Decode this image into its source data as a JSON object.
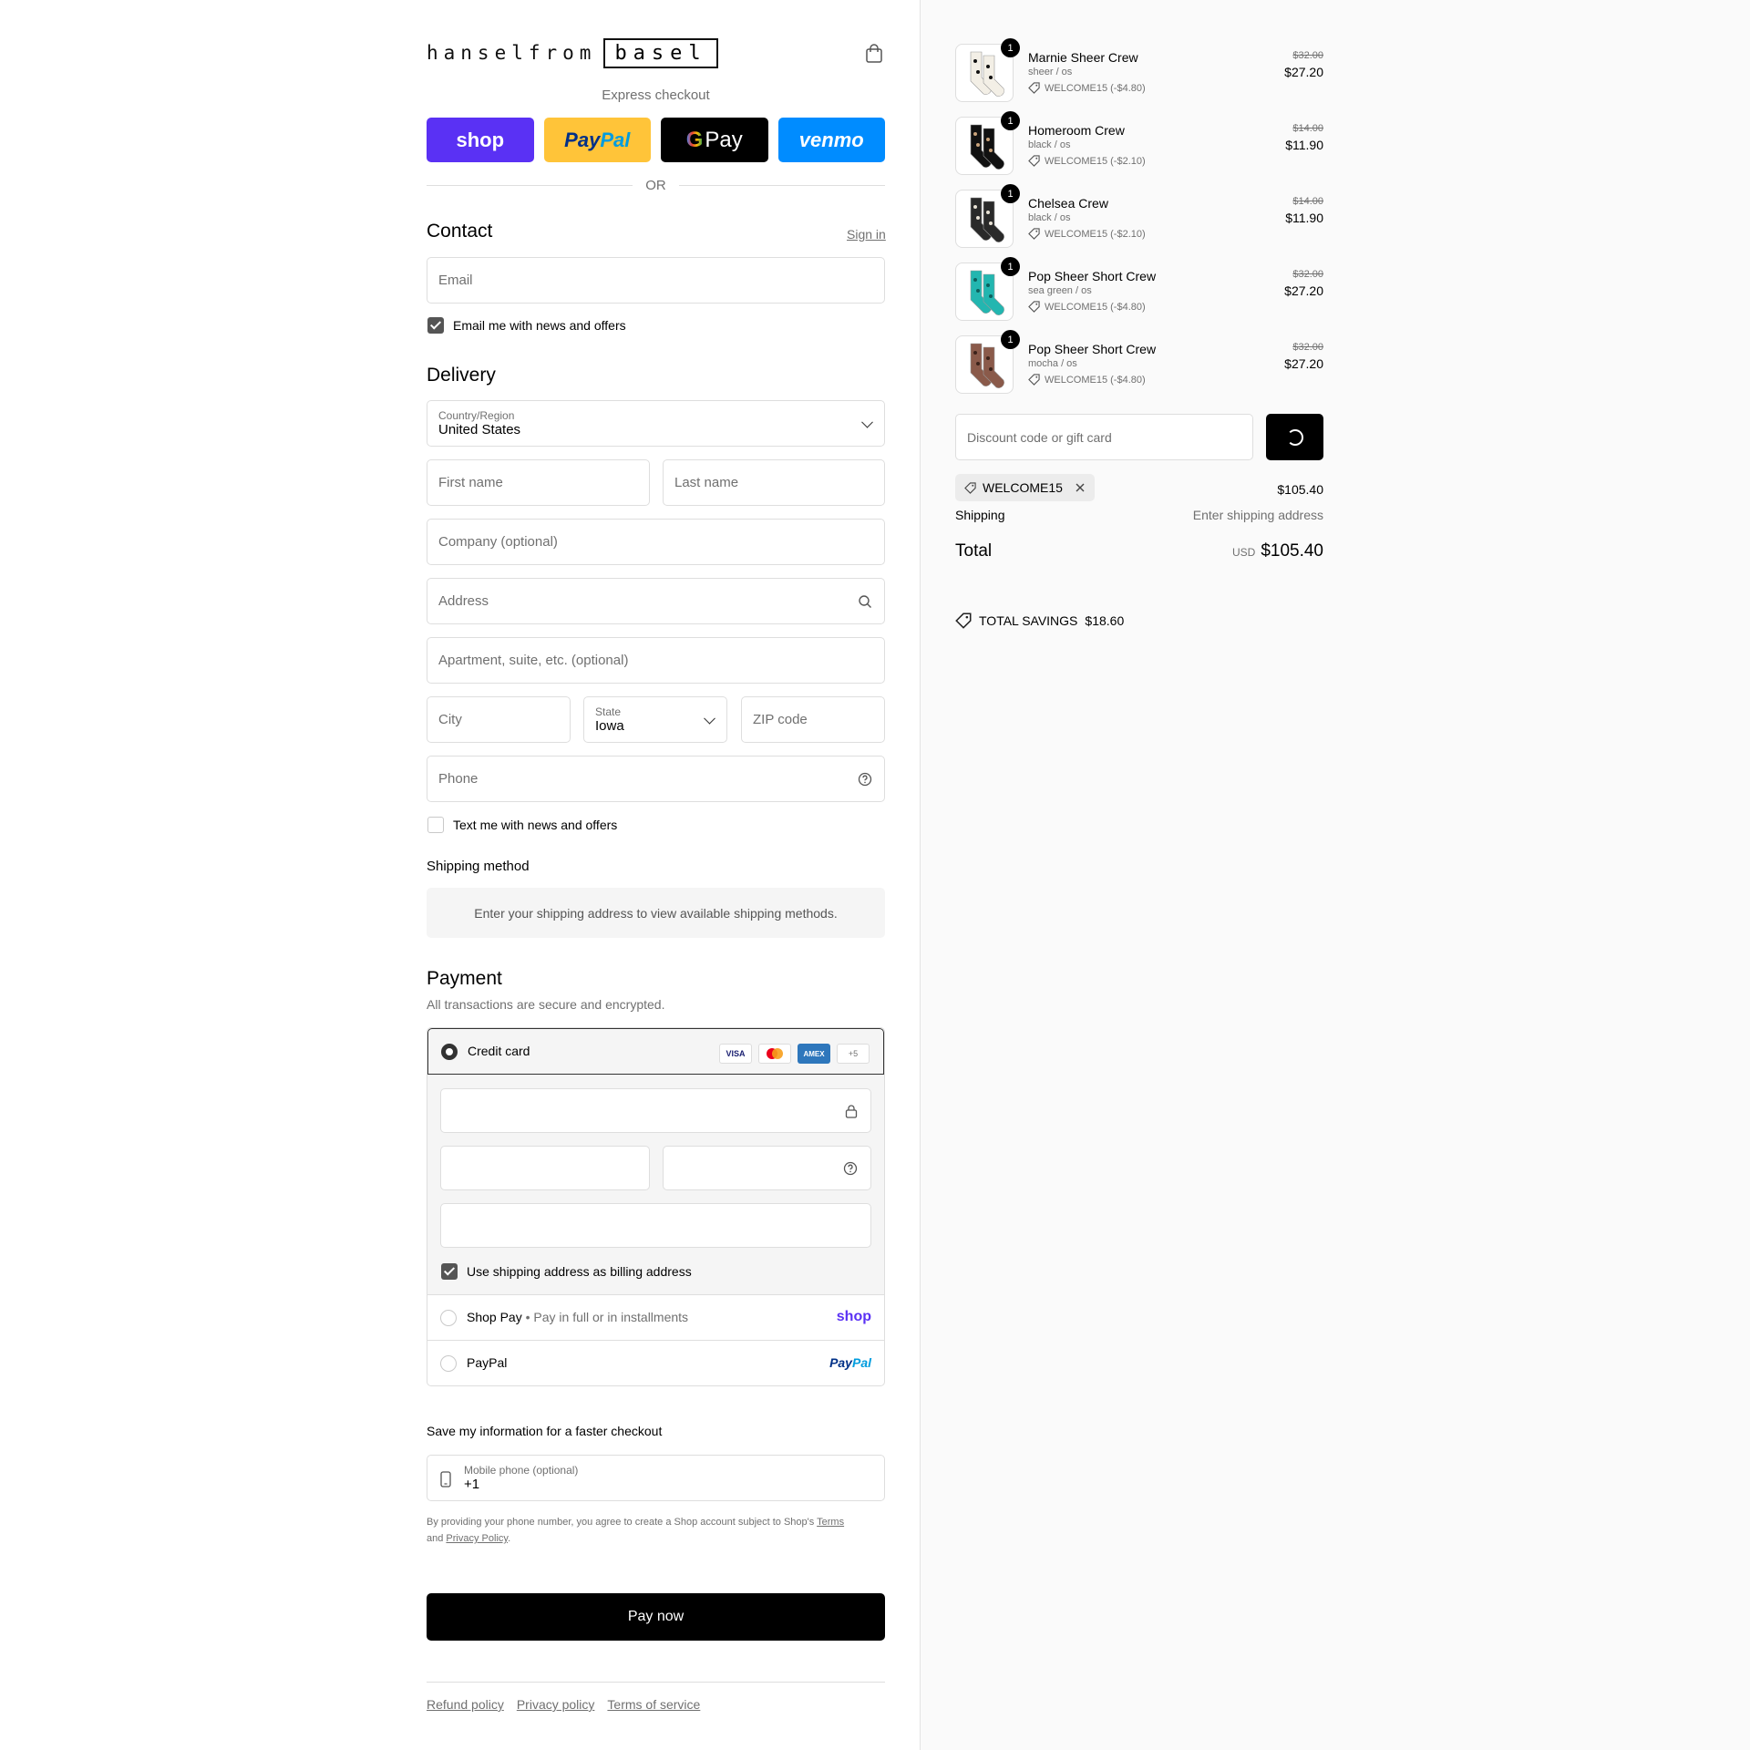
{
  "header": {
    "logo_part1": "hanselfrom",
    "logo_part2": "basel",
    "cart_icon": "shopping-bag-icon"
  },
  "express": {
    "label": "Express checkout",
    "buttons": [
      "shop",
      "PayPal",
      "Pay",
      "venmo"
    ],
    "or_label": "OR"
  },
  "contact": {
    "title": "Contact",
    "sign_in": "Sign in",
    "email_placeholder": "Email",
    "news_label": "Email me with news and offers",
    "news_checked": true
  },
  "delivery": {
    "title": "Delivery",
    "country_label": "Country/Region",
    "country_value": "United States",
    "first_name": "First name",
    "last_name": "Last name",
    "company": "Company (optional)",
    "address": "Address",
    "apartment": "Apartment, suite, etc. (optional)",
    "city": "City",
    "state_label": "State",
    "state_value": "Iowa",
    "zip": "ZIP code",
    "phone": "Phone",
    "text_label": "Text me with news and offers",
    "text_checked": false
  },
  "shipping": {
    "title": "Shipping method",
    "note": "Enter your shipping address to view available shipping methods."
  },
  "payment": {
    "title": "Payment",
    "subtitle": "All transactions are secure and encrypted.",
    "credit_card": "Credit card",
    "card_logos": [
      "VISA",
      "MC",
      "AMEX",
      "+5"
    ],
    "billing_label": "Use shipping address as billing address",
    "shop_pay": "Shop Pay",
    "shop_pay_sub": "Pay in full or in installments",
    "shop_logo": "shop",
    "paypal": "PayPal",
    "paypal_logo": "PayPal"
  },
  "save_info": {
    "title": "Save my information for a faster checkout",
    "phone_label": "Mobile phone (optional)",
    "phone_value": "+1",
    "legal_prefix": "By providing your phone number, you agree to create a Shop account subject to Shop's",
    "terms": "Terms",
    "and": "and",
    "privacy": "Privacy Policy",
    "period": "."
  },
  "pay_now": "Pay now",
  "footer": [
    "Refund policy",
    "Privacy policy",
    "Terms of service"
  ],
  "cart": {
    "items": [
      {
        "name": "Marnie Sheer Crew",
        "variant": "sheer / os",
        "discount": "WELCOME15 (-$4.80)",
        "orig": "$32.00",
        "price": "$27.20",
        "qty": "1",
        "color": "#f3efe6",
        "accent": "#111111"
      },
      {
        "name": "Homeroom Crew",
        "variant": "black / os",
        "discount": "WELCOME15 (-$2.10)",
        "orig": "$14.00",
        "price": "$11.90",
        "qty": "1",
        "color": "#111111",
        "accent": "#c9a27a"
      },
      {
        "name": "Chelsea Crew",
        "variant": "black / os",
        "discount": "WELCOME15 (-$2.10)",
        "orig": "$14.00",
        "price": "$11.90",
        "qty": "1",
        "color": "#2a2a2a",
        "accent": "#e9e3d6"
      },
      {
        "name": "Pop Sheer Short Crew",
        "variant": "sea green / os",
        "discount": "WELCOME15 (-$4.80)",
        "orig": "$32.00",
        "price": "$27.20",
        "qty": "1",
        "color": "#23b6b0",
        "accent": "#0d5f5c"
      },
      {
        "name": "Pop Sheer Short Crew",
        "variant": "mocha / os",
        "discount": "WELCOME15 (-$4.80)",
        "orig": "$32.00",
        "price": "$27.20",
        "qty": "1",
        "color": "#8a5a4a",
        "accent": "#3b221a"
      }
    ],
    "discount_placeholder": "Discount code or gift card",
    "applied_code": "WELCOME15",
    "subtotal": "$105.40",
    "shipping_label": "Shipping",
    "shipping_value": "Enter shipping address",
    "total_label": "Total",
    "currency": "USD",
    "total_value": "$105.40",
    "savings_label": "TOTAL SAVINGS",
    "savings_value": "$18.60"
  }
}
